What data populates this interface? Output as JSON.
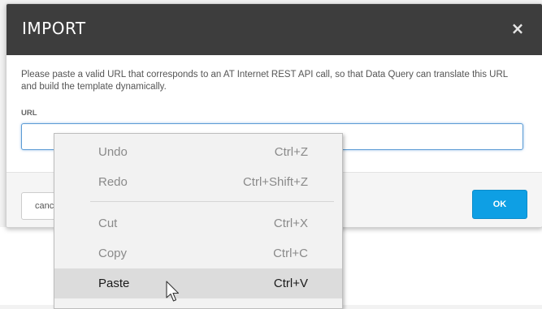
{
  "modal": {
    "title": "IMPORT",
    "close_symbol": "×",
    "instructions": "Please paste a valid URL that corresponds to an AT Internet REST API call, so that Data Query can translate this URL and build the template dynamically.",
    "url_label": "URL",
    "url_value": "",
    "cancel_label": "cancel",
    "ok_label": "OK"
  },
  "context_menu": {
    "items": [
      {
        "label": "Undo",
        "shortcut": "Ctrl+Z",
        "enabled": false
      },
      {
        "label": "Redo",
        "shortcut": "Ctrl+Shift+Z",
        "enabled": false
      },
      {
        "label": "Cut",
        "shortcut": "Ctrl+X",
        "enabled": false
      },
      {
        "label": "Copy",
        "shortcut": "Ctrl+C",
        "enabled": false
      },
      {
        "label": "Paste",
        "shortcut": "Ctrl+V",
        "enabled": true,
        "highlighted": true
      }
    ]
  },
  "colors": {
    "header_bg": "#3d3d3d",
    "ok_button": "#0e9fe4",
    "input_focus": "#5b9bd5",
    "menu_highlight": "#dcdcdc"
  },
  "icons": {
    "close": "close-icon",
    "cursor": "mouse-pointer-icon"
  }
}
